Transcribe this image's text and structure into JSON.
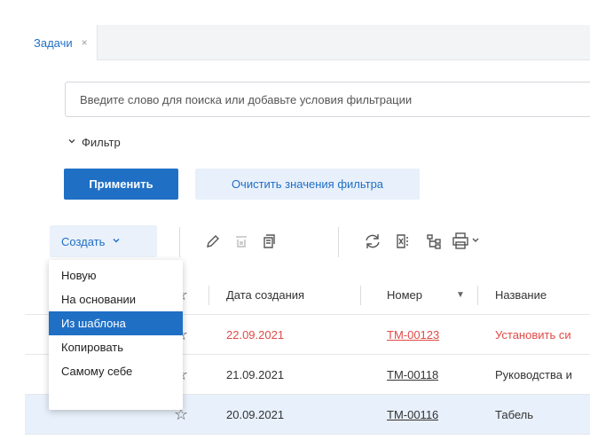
{
  "tab": {
    "label": "Задачи",
    "close": "×"
  },
  "search": {
    "placeholder": "Введите слово для поиска или добавьте условия фильтрации"
  },
  "filter": {
    "label": "Фильтр"
  },
  "buttons": {
    "apply": "Применить",
    "clear": "Очистить значения фильтра"
  },
  "toolbar": {
    "create_label": "Создать",
    "icons": [
      "edit-icon",
      "delete-icon",
      "template-icon",
      "refresh-icon",
      "excel-icon",
      "hierarchy-icon",
      "print-icon"
    ]
  },
  "dropdown": {
    "items": [
      "Новую",
      "На основании",
      "Из шаблона",
      "Копировать",
      "Самому себе"
    ],
    "active": "Из шаблона"
  },
  "table": {
    "headers": {
      "date": "Дата создания",
      "number": "Номер",
      "name": "Название"
    },
    "rows": [
      {
        "date": "22.09.2021",
        "number": "ТМ-00123",
        "name": "Установить си",
        "status_color": "#e04a46"
      },
      {
        "date": "21.09.2021",
        "number": "ТМ-00118",
        "name": "Руководства и"
      },
      {
        "date": "20.09.2021",
        "number": "ТМ-00116",
        "name": "Табель"
      }
    ]
  },
  "colors": {
    "accent": "#1f6fc5",
    "overdue": "#e04a46",
    "selected_row": "#e8f0fb"
  }
}
